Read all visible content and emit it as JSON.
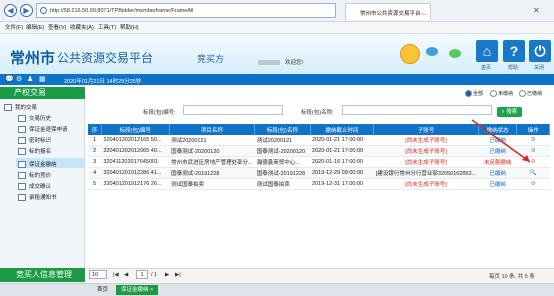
{
  "browser": {
    "back": "◀",
    "forward": "▶",
    "url": "http://58.216.50.99:8071/TPBidder/memberframe/FrameAll",
    "tab_title": "常州市公共资源交易平台-...",
    "menu": [
      "文件(F)",
      "编辑(E)",
      "查看(V)",
      "收藏夹(A)",
      "工具(T)",
      "帮助(H)"
    ]
  },
  "header": {
    "logo_main": "常州市",
    "logo_sub": "公共资源交易平台",
    "role": "竞买方",
    "welcome": "欢迎您!",
    "nav": [
      {
        "label": "首页",
        "icon": "home-icon"
      },
      {
        "label": "帮助",
        "icon": "help-icon"
      },
      {
        "label": "关闭",
        "icon": "power-icon"
      }
    ],
    "datetime": "2020年01月21日 14时29分25秒"
  },
  "sidebar": {
    "title": "产权交易",
    "root": "我的交易",
    "items": [
      "交易历史",
      "保证金退保申请",
      "密封标识",
      "标的报名",
      "保证金缴纳",
      "标的竞价",
      "成交确认",
      "录租通知书"
    ],
    "active_index": 4,
    "footer": "竞买人信息管理"
  },
  "filters": {
    "radios": [
      "全部",
      "未缴纳",
      "已缴纳"
    ],
    "selected_radio": 0,
    "code_label": "标段(包)编号:",
    "name_label": "标段(包)名称:",
    "search_label": "搜索"
  },
  "table": {
    "headers": [
      "序",
      "标段(包)编号",
      "项目名称",
      "标段(包)名称",
      "缴纳截止时间",
      "子账号",
      "缴纳状态",
      "操作"
    ],
    "rows": [
      {
        "n": "1",
        "code": "320401202012165 50...",
        "project": "测试20200121",
        "name": "测试20200121",
        "deadline": "2020-01-21 17:00:00",
        "account": "[尚未生成子账号]",
        "status": "已缴纳",
        "op": "⚙"
      },
      {
        "n": "2",
        "code": "320401202012065 40...",
        "project": "国泰测试-20200120",
        "name": "国泰测试-20200120",
        "deadline": "2020-01-21 17:00:00",
        "account": "[尚未生成子账号]",
        "status": "已缴纳",
        "op": "⚙"
      },
      {
        "n": "3",
        "code": "320411202017645001",
        "project": "常州市武进区房地产管理处部分...",
        "name": "瀚德鑫商贸中心...",
        "deadline": "2020-01-16 17:00:00",
        "account": "[尚未生成子账号]",
        "status": "未足额缴纳",
        "op": "⚙"
      },
      {
        "n": "4",
        "code": "320401201912286 41...",
        "project": "国泰测试-20191228",
        "name": "国泰测试-20191228",
        "deadline": "2019-12-29 09:00:00",
        "account": "[建设银行常州分行营业部32050162863...",
        "status": "已缴纳",
        "op": "🔍"
      },
      {
        "n": "5",
        "code": "320401201912176 26...",
        "project": "测试国泰拍卖",
        "name": "测试国泰拍卖",
        "deadline": "2019-12-31 17:00:00",
        "account": "[尚未生成子账号]",
        "status": "已缴纳",
        "op": "⚙"
      }
    ]
  },
  "pager": {
    "page_size": "10",
    "page": "1",
    "of": "/ 1",
    "summary": "每页 10 条, 共 5 条"
  },
  "taskbar": {
    "home": "首页",
    "active": "保证金缴纳 ×"
  },
  "colors": {
    "brand_blue": "#0f74c7",
    "green": "#1a9b44",
    "red": "#e0261c"
  }
}
